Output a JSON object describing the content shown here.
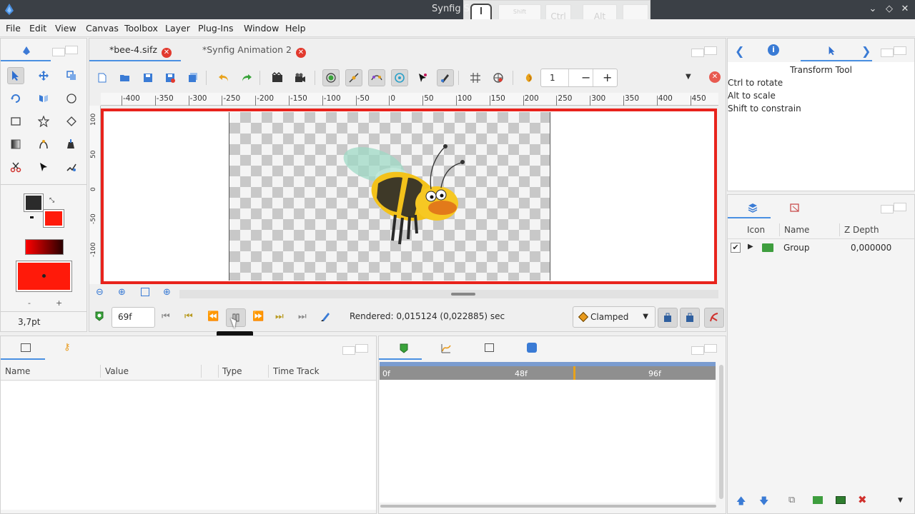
{
  "window": {
    "title": "Synfig S",
    "controls": [
      "chevron-down",
      "diamond",
      "close"
    ]
  },
  "overlay": {
    "keys": [
      "Shift",
      "Ctrl",
      "Alt",
      ""
    ]
  },
  "menu": [
    "File",
    "Edit",
    "View",
    "Canvas",
    "Toolbox",
    "Layer",
    "Plug-Ins",
    "Window",
    "Help"
  ],
  "toolbox": {
    "brush_size": "3,7pt",
    "minus": "-",
    "plus": "+",
    "colors": {
      "outline": "#2b2b2b",
      "fill": "#ff1a0a",
      "gradient_from": "#ff0000",
      "gradient_to": "#2a0000"
    }
  },
  "canvas": {
    "tabs": [
      {
        "label": "*bee-4.sifz"
      },
      {
        "label": "*Synfig Animation 2"
      }
    ],
    "zoom_value": "1",
    "zoom_minus": "−",
    "zoom_plus": "+",
    "ruler_h": [
      "-400",
      "-350",
      "-300",
      "-250",
      "-200",
      "-150",
      "-100",
      "-50",
      "0",
      "50",
      "100",
      "150",
      "200",
      "250",
      "300",
      "350",
      "400",
      "450"
    ],
    "ruler_v": [
      "100",
      "50",
      "0",
      "-50",
      "-100"
    ],
    "frame": "69f",
    "rendered": "Rendered: 0,015124 (0,022885) sec",
    "interpolation": "Clamped",
    "tooltip": "Pause"
  },
  "tool_options": {
    "title": "Transform Tool",
    "lines": [
      "Ctrl to rotate",
      "Alt to scale",
      "Shift to constrain"
    ]
  },
  "layers": {
    "columns": {
      "icon": "Icon",
      "name": "Name",
      "zdepth": "Z Depth"
    },
    "rows": [
      {
        "name": "Group",
        "zdepth": "0,000000",
        "checked": true
      }
    ]
  },
  "params": {
    "columns": {
      "name": "Name",
      "value": "Value",
      "type": "Type",
      "timetrack": "Time Track"
    }
  },
  "timetrack": {
    "labels": [
      "0f",
      "48f",
      "96f"
    ],
    "cursor_frame": 69
  }
}
